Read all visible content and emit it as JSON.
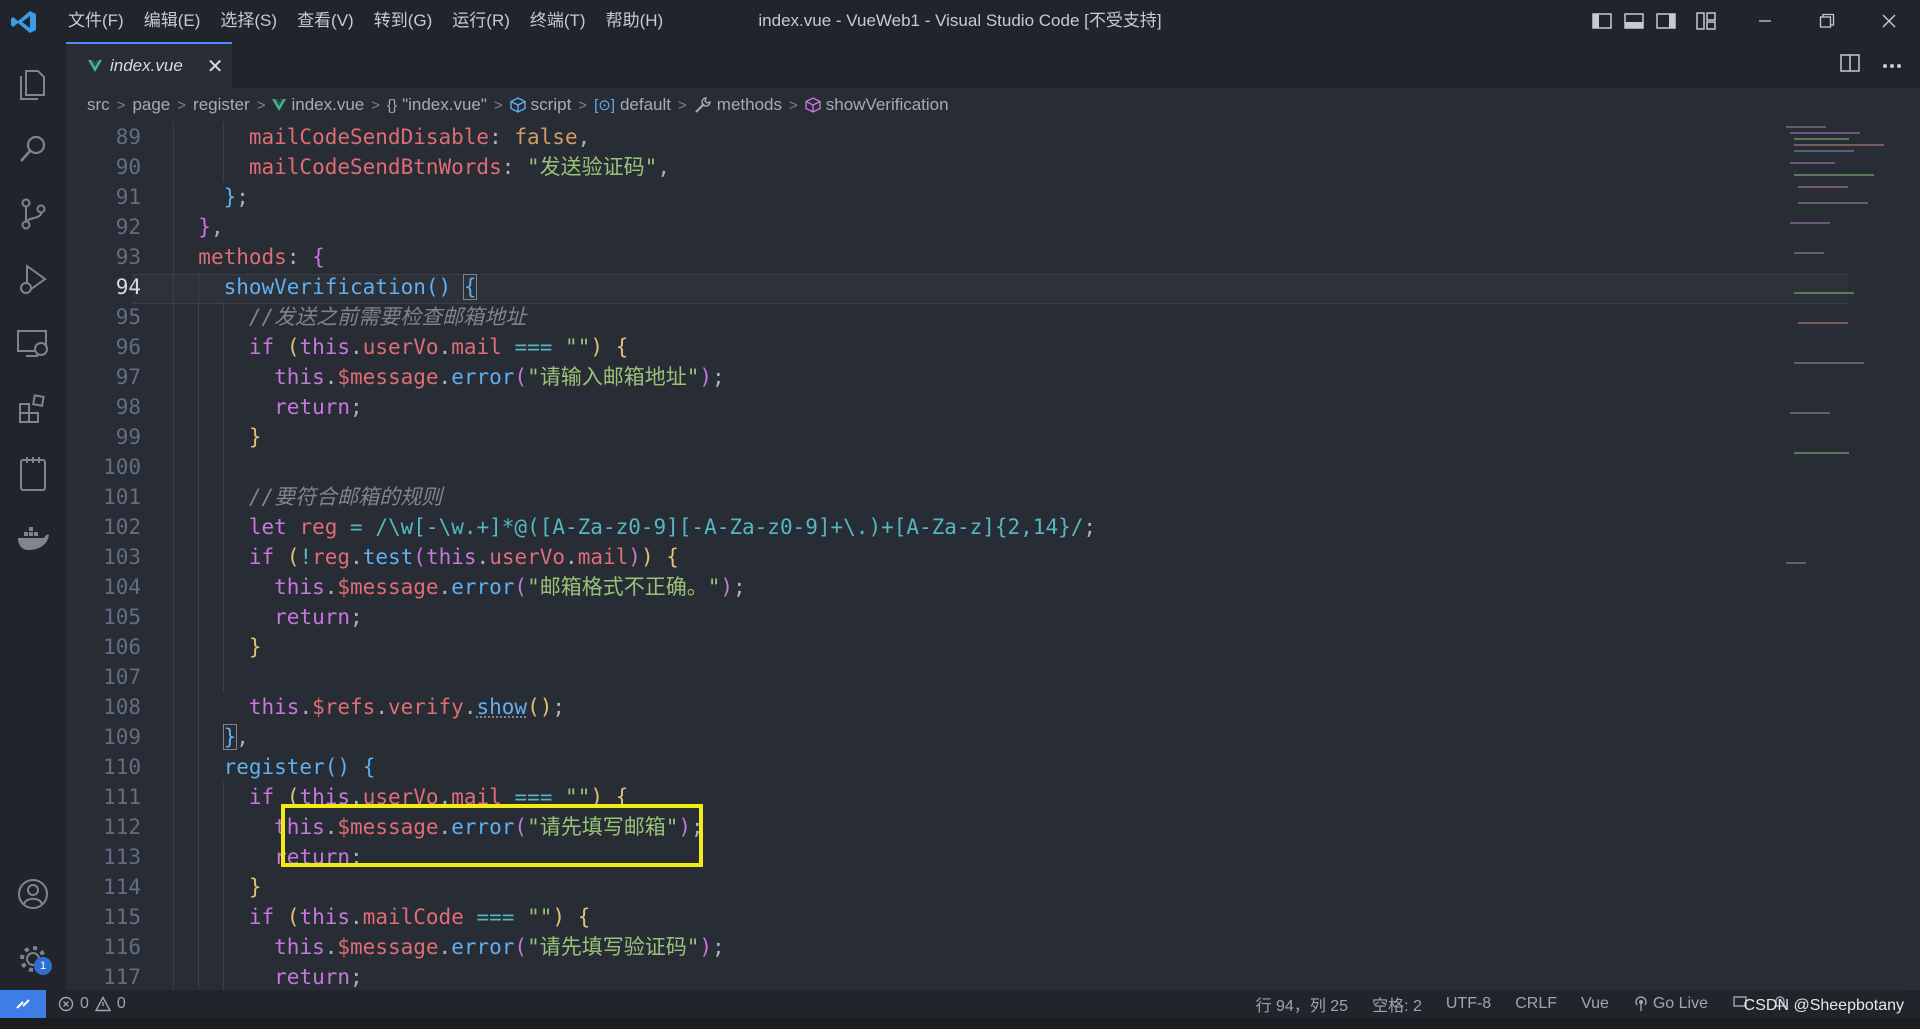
{
  "titlebar": {
    "menu": [
      "文件(F)",
      "编辑(E)",
      "选择(S)",
      "查看(V)",
      "转到(G)",
      "运行(R)",
      "终端(T)",
      "帮助(H)"
    ],
    "title": "index.vue - VueWeb1 - Visual Studio Code [不受支持]"
  },
  "activity": {
    "items": [
      "explorer",
      "search",
      "source-control",
      "run-debug",
      "remote-explorer",
      "extensions",
      "notes",
      "docker"
    ],
    "settings_badge": "1"
  },
  "tab": {
    "label": "index.vue",
    "close": "✕"
  },
  "breadcrumb": {
    "items": [
      "src",
      "page",
      "register",
      "index.vue",
      "\"index.vue\"",
      "script",
      "default",
      "methods",
      "showVerification"
    ]
  },
  "editor": {
    "line_numbers": [
      "89",
      "90",
      "91",
      "92",
      "93",
      "94",
      "95",
      "96",
      "97",
      "98",
      "99",
      "100",
      "101",
      "102",
      "103",
      "104",
      "105",
      "106",
      "107",
      "108",
      "109",
      "110",
      "111",
      "112",
      "113",
      "114",
      "115",
      "116",
      "117"
    ],
    "active_line": "94",
    "strings": {
      "send_btn_words": "\"发送验证码\"",
      "empty": "\"\"",
      "err_input_mail": "\"请输入邮箱地址\"",
      "err_mail_format": "\"邮箱格式不正确。\"",
      "err_fill_mail": "\"请先填写邮箱\"",
      "err_fill_code": "\"请先填写验证码\""
    },
    "comments": {
      "check_mail": "//发送之前需要检查邮箱地址",
      "mail_rule": "//要符合邮箱的规则"
    },
    "regex": "/\\w[-\\w.+]*@([A-Za-z0-9][-A-Za-z0-9]+\\.)+[A-Za-z]{2,14}/"
  },
  "statusbar": {
    "errors": "0",
    "warnings": "0",
    "position": "行 94，列 25",
    "spaces": "空格: 2",
    "encoding": "UTF-8",
    "eol": "CRLF",
    "language": "Vue",
    "golive": "Go Live"
  },
  "watermark": "CSDN @Sheepbotany",
  "colors": {
    "accent": "#528bff",
    "highlight_box": "#f1ed13",
    "status_remote": "#3e7ce6"
  }
}
